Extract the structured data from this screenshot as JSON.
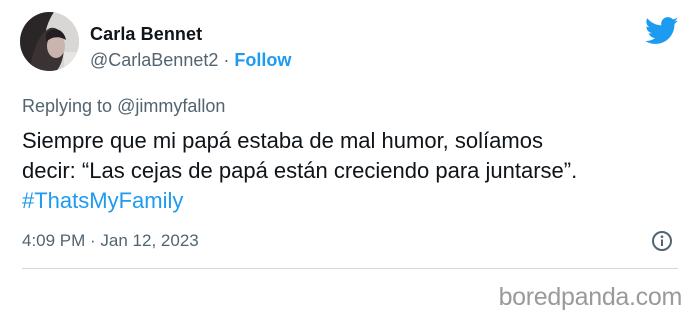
{
  "tweet": {
    "author": {
      "display_name": "Carla Bennet",
      "handle": "@CarlaBennet2",
      "separator": " · ",
      "follow_label": "Follow"
    },
    "reply": {
      "prefix": "Replying to ",
      "mention": "@jimmyfallon"
    },
    "text_lines": [
      "Siempre que mi papá estaba de mal humor, solíamos",
      "decir: “Las cejas de papá están creciendo para juntarse”."
    ],
    "hashtag": "#ThatsMyFamily",
    "timestamp": "4:09 PM · Jan 12, 2023"
  },
  "icons": {
    "brand": "twitter-bird-icon",
    "info": "info-icon"
  },
  "colors": {
    "accent": "#1d9bf0",
    "text": "#0f1419",
    "muted": "#536471",
    "divider": "#cfd9de"
  },
  "watermark": "boredpanda.com"
}
